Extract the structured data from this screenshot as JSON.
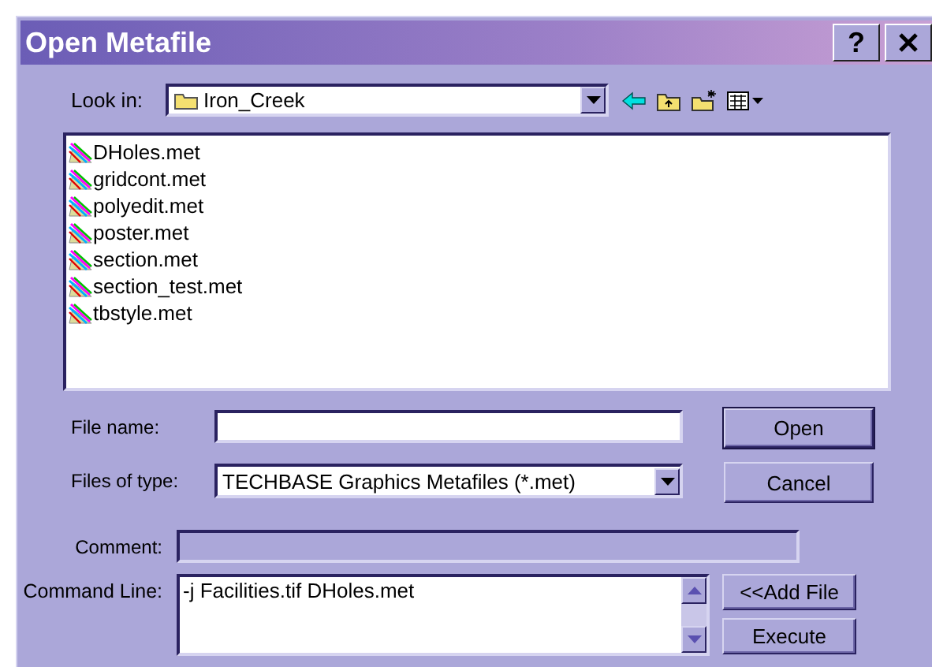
{
  "window": {
    "title": "Open Metafile",
    "help_button": "?"
  },
  "look_in": {
    "label": "Look in:",
    "value": "Iron_Creek"
  },
  "files": [
    {
      "name": "DHoles.met"
    },
    {
      "name": "gridcont.met"
    },
    {
      "name": "polyedit.met"
    },
    {
      "name": "poster.met"
    },
    {
      "name": "section.met"
    },
    {
      "name": "section_test.met"
    },
    {
      "name": "tbstyle.met"
    }
  ],
  "file_name": {
    "label": "File name:"
  },
  "files_of_type": {
    "label": "Files of type:",
    "value": "TECHBASE Graphics Metafiles (*.met)"
  },
  "comment": {
    "label": "Comment:",
    "disabled": true
  },
  "command_line": {
    "label": "Command Line:",
    "value": "-j Facilities.tif DHoles.met"
  },
  "buttons": {
    "open": "Open",
    "cancel": "Cancel",
    "add_file": "<<Add File",
    "execute": "Execute"
  }
}
